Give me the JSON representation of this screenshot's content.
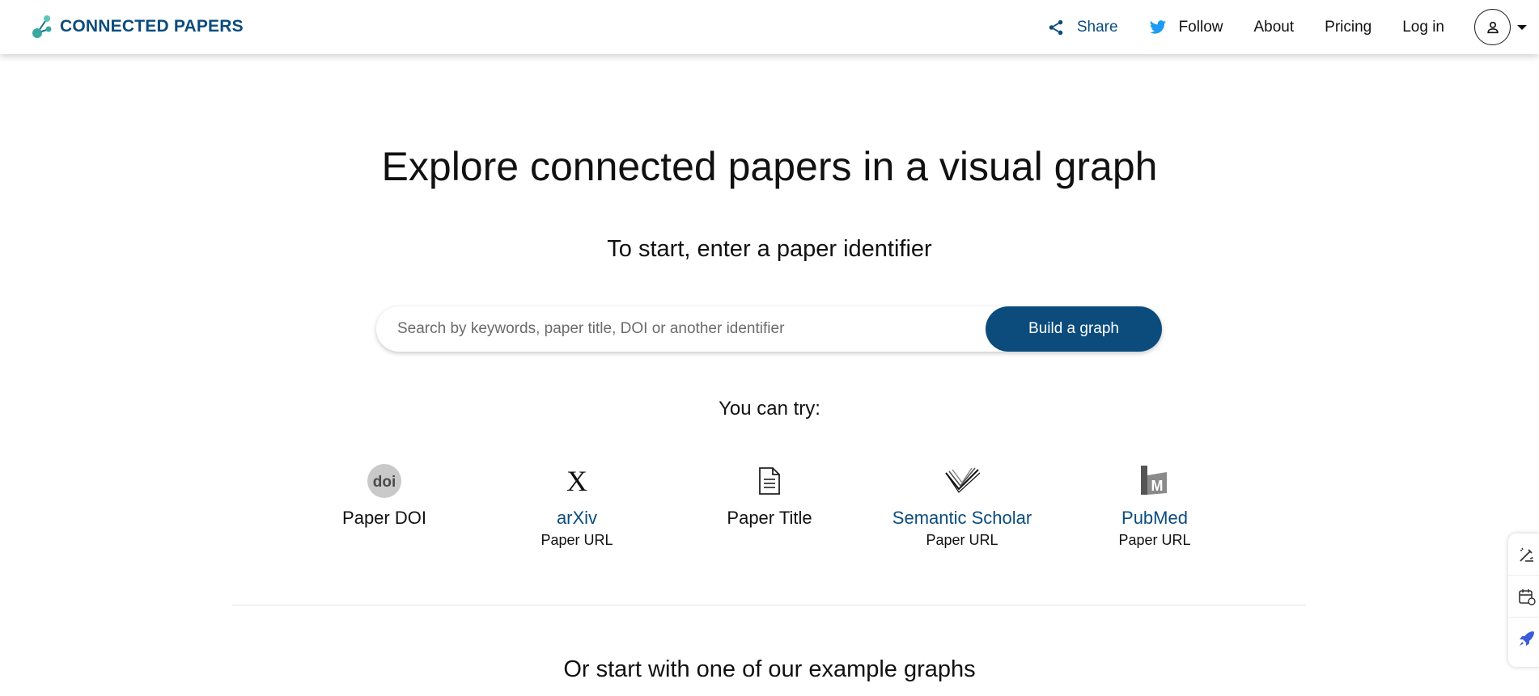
{
  "brand": {
    "name": "CONNECTED PAPERS",
    "color": "#0c4c7d",
    "mark_colors": [
      "#3aa7a0",
      "#5fc4b8",
      "#1f6f8b"
    ]
  },
  "nav": {
    "share_label": "Share",
    "follow_label": "Follow",
    "about_label": "About",
    "pricing_label": "Pricing",
    "login_label": "Log in",
    "share_icon": "share-icon",
    "follow_icon": "twitter-icon",
    "twitter_color": "#1d9bf0"
  },
  "hero": {
    "title": "Explore connected papers in a visual graph",
    "subtitle": "To start, enter a paper identifier"
  },
  "search": {
    "placeholder": "Search by keywords, paper title, DOI or another identifier",
    "value": "",
    "button_label": "Build a graph"
  },
  "try": {
    "label": "You can try:",
    "items": [
      {
        "icon": "doi-icon",
        "label": "Paper DOI",
        "sub": ""
      },
      {
        "icon": "arxiv-icon",
        "label": "arXiv",
        "sub": "Paper URL"
      },
      {
        "icon": "document-icon",
        "label": "Paper Title",
        "sub": ""
      },
      {
        "icon": "semantic-scholar-icon",
        "label": "Semantic Scholar",
        "sub": "Paper URL"
      },
      {
        "icon": "pubmed-icon",
        "label": "PubMed",
        "sub": "Paper URL"
      }
    ]
  },
  "examples": {
    "heading": "Or start with one of our example graphs"
  },
  "side_widget": {
    "icons": [
      "edit-wand-icon",
      "calendar-edit-icon",
      "rocket-icon"
    ],
    "accent": "#3b5bdb"
  }
}
